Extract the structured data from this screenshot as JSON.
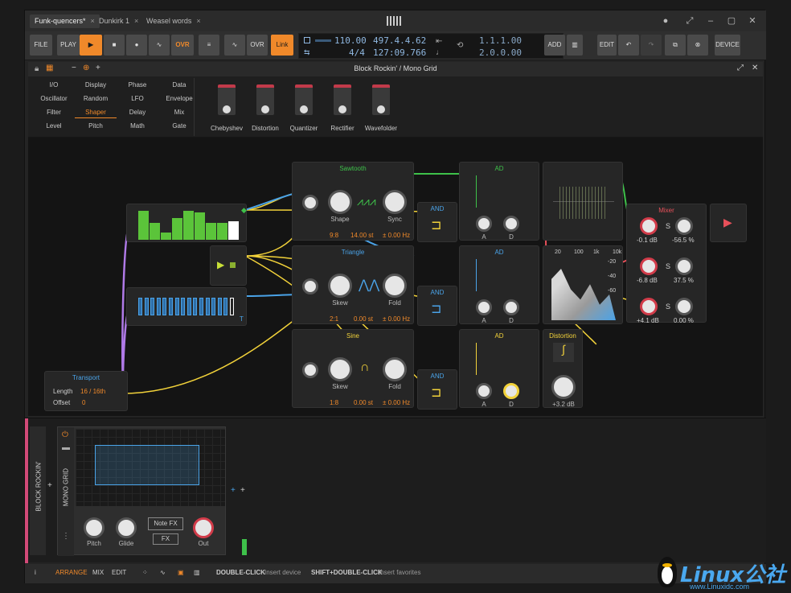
{
  "tabs": [
    {
      "label": "Funk-quencers*",
      "active": true
    },
    {
      "label": "Dunkirk 1"
    },
    {
      "label": "Weasel words"
    }
  ],
  "transport": {
    "file": "FILE",
    "play": "PLAY",
    "ovr": "OVR",
    "ovr2": "OVR",
    "link": "Link",
    "tempo": "110.00",
    "sig": "4/4",
    "pos": "497.4.4.62",
    "time": "127:09.766",
    "loop_start": "1.1.1.00",
    "loop_len": "2.0.0.00",
    "add": "ADD",
    "edit": "EDIT",
    "device": "DEVICE"
  },
  "panel": {
    "title": "Block Rockin' / Mono Grid"
  },
  "browser": {
    "categories": [
      [
        "I/O",
        "Display",
        "Phase",
        "Data"
      ],
      [
        "Oscillator",
        "Random",
        "LFO",
        "Envelope"
      ],
      [
        "Filter",
        "Shaper",
        "Delay",
        "Mix"
      ],
      [
        "Level",
        "Pitch",
        "Math",
        "Gate"
      ]
    ],
    "selected": "Shaper",
    "devices": [
      "Chebyshev",
      "Distortion",
      "Quantizer",
      "Rectifier",
      "Wavefolder"
    ]
  },
  "modules": {
    "sawtooth": {
      "title": "Sawtooth",
      "k1": "Shape",
      "k2": "Sync",
      "ratio": "9:8",
      "st": "14.00 st",
      "hz": "± 0.00 Hz"
    },
    "triangle": {
      "title": "Triangle",
      "k1": "Skew",
      "k2": "Fold",
      "ratio": "2:1",
      "st": "0.00 st",
      "hz": "± 0.00 Hz"
    },
    "sine": {
      "title": "Sine",
      "k1": "Skew",
      "k2": "Fold",
      "ratio": "1:8",
      "st": "0.00 st",
      "hz": "± 0.00 Hz"
    },
    "and": "AND",
    "ad": "AD",
    "a": "A",
    "d": "D",
    "mixer": {
      "title": "Mixer",
      "r1": [
        "-0.1 dB",
        "S",
        "-56.5 %"
      ],
      "r2": [
        "-6.8 dB",
        "S",
        "37.5 %"
      ],
      "r3": [
        "+4.1 dB",
        "S",
        "0.00 %"
      ]
    },
    "distortion": {
      "title": "Distortion",
      "val": "+3.2 dB"
    },
    "spectrum_ticks": [
      "20",
      "100",
      "1k",
      "10k"
    ],
    "spectrum_db": [
      "-20",
      "-40",
      "-60"
    ],
    "transportmod": {
      "title": "Transport",
      "len_lbl": "Length",
      "len_val": "16 / 16th",
      "off_lbl": "Offset",
      "off_val": "0"
    },
    "t": "T"
  },
  "track": {
    "name": "BLOCK ROCKIN'",
    "device": "MONO GRID",
    "pitch": "Pitch",
    "glide": "Glide",
    "out": "Out",
    "notefx": "Note FX",
    "fx": "FX"
  },
  "status": {
    "arrange": "ARRANGE",
    "mix": "MIX",
    "edit": "EDIT",
    "dbl": "DOUBLE-CLICK",
    "dbl_hint": "Insert device",
    "sdbl": "SHIFT+DOUBLE-CLICK",
    "sdbl_hint": "Insert favorites"
  },
  "watermark": "Linux公社",
  "watermark_url": "www.Linuxidc.com",
  "colors": {
    "accent": "#f0892a",
    "green": "#3ec14a",
    "blue": "#4aa3e8",
    "yellow": "#f2d23a",
    "red": "#e8505a",
    "purple": "#b07ae8"
  }
}
